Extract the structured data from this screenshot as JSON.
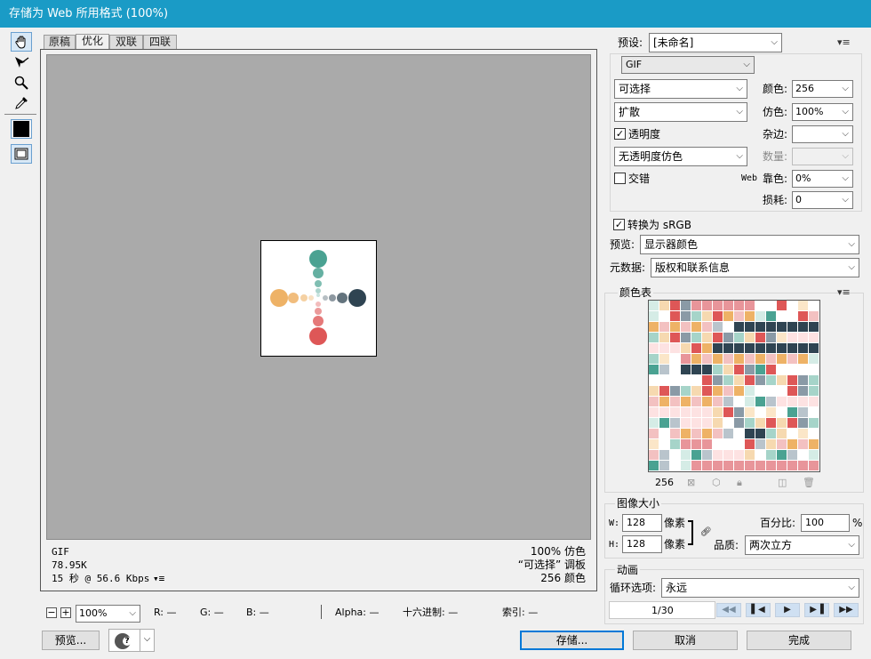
{
  "window": {
    "title": "存储为 Web 所用格式 (100%)"
  },
  "tabs": [
    "原稿",
    "优化",
    "双联",
    "四联"
  ],
  "info": {
    "format": "GIF",
    "size": "78.95K",
    "time": "15 秒 @ 56.6 Kbps",
    "dither_pct": "100% 仿色",
    "palette_info": "“可选择” 调板",
    "colors_info": "256 颜色"
  },
  "status": {
    "zoom": "100%",
    "r": "R: —",
    "g": "G: —",
    "b": "B: —",
    "alpha": "Alpha: —",
    "hex": "十六进制: —",
    "index": "索引: —"
  },
  "bottom": {
    "preview": "预览...",
    "save": "存储...",
    "cancel": "取消",
    "done": "完成"
  },
  "settings": {
    "preset_label": "预设:",
    "preset": "[未命名]",
    "format": "GIF",
    "reduction": "可选择",
    "dither_algo": "扩散",
    "transparency": "透明度",
    "transparency_dither": "无透明度仿色",
    "interlaced": "交错",
    "colors_label": "颜色:",
    "colors": "256",
    "dither_label": "仿色:",
    "dither": "100%",
    "matte_label": "杂边:",
    "matte": "",
    "amount_label": "数量:",
    "amount": "",
    "web_snap_prefix": "Web",
    "web_snap_label": "靠色:",
    "web_snap": "0%",
    "lossy_label": "损耗:",
    "lossy": "0",
    "convert_srgb": "转换为 sRGB",
    "preview_label": "预览:",
    "preview_value": "显示器颜色",
    "metadata_label": "元数据:",
    "metadata_value": "版权和联系信息"
  },
  "color_table": {
    "title": "颜色表",
    "count": "256"
  },
  "image_size": {
    "title": "图像大小",
    "w_label": "W:",
    "width": "128",
    "w_unit": "像素",
    "h_label": "H:",
    "height": "128",
    "h_unit": "像素",
    "percent_label": "百分比:",
    "percent": "100",
    "percent_unit": "%",
    "quality_label": "品质:",
    "quality": "两次立方"
  },
  "animation": {
    "title": "动画",
    "loop_label": "循环选项:",
    "loop": "永远",
    "frame": "1/30"
  },
  "colors": {
    "teal": "#4aa292",
    "orange": "#eeb266",
    "navy": "#2f4452",
    "red": "#de5757",
    "title_bar": "#1a9bc6"
  },
  "icons": {
    "hand": "hand-icon",
    "slice": "slice-select-icon",
    "zoom": "zoom-icon",
    "eyedropper": "eyedropper-icon"
  }
}
